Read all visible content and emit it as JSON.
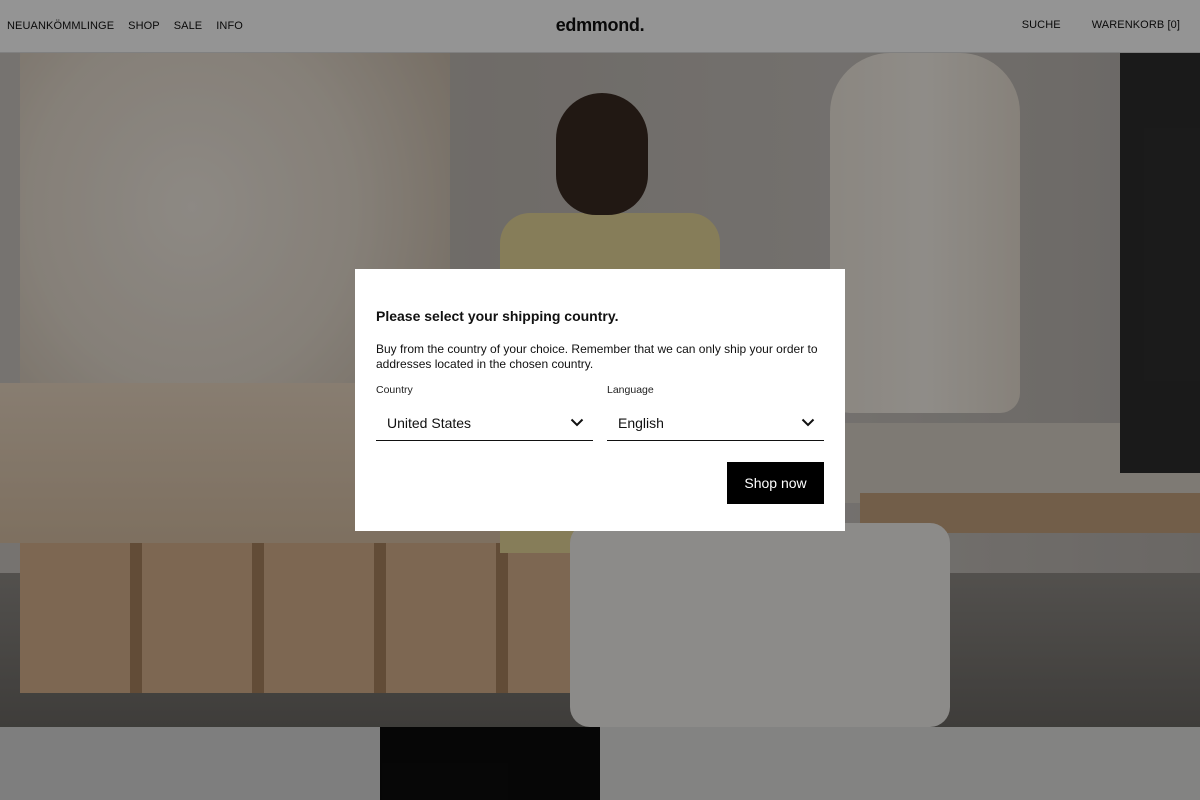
{
  "header": {
    "nav_left": [
      "NEUANKÖMMLINGE",
      "SHOP",
      "SALE",
      "INFO"
    ],
    "logo": "edmmond.",
    "search": "SUCHE",
    "cart": "WARENKORB [0]"
  },
  "modal": {
    "title": "Please select your shipping country.",
    "description": "Buy from the country of your choice. Remember that we can only ship your order to addresses located in the chosen country.",
    "country_label": "Country",
    "country_value": "United States",
    "language_label": "Language",
    "language_value": "English",
    "submit_label": "Shop now"
  },
  "icons": {
    "country_dropdown": "chevron-down-icon",
    "language_dropdown": "chevron-down-icon"
  },
  "colors": {
    "overlay": "#000000",
    "button_background": "#000000",
    "button_text": "#ffffff",
    "modal_background": "#ffffff"
  }
}
